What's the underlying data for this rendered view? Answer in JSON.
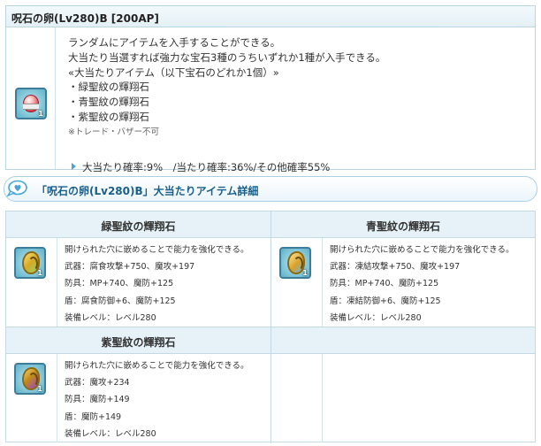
{
  "item": {
    "title": "呪石の卵(Lv280)B [200AP]",
    "icon": "red-egg-icon",
    "quantity": "1",
    "description": [
      "ランダムにアイテムを入手することができる。",
      "大当たり当選すれば強力な宝石3種のうちいずれか1種が入手できる。",
      "«大当たりアイテム（以下宝石のどれか1個）»",
      "・緑聖紋の輝翔石",
      "・青聖紋の輝翔石",
      "・紫聖紋の輝翔石"
    ],
    "note": "※トレード・バザー不可",
    "rates": "大当たり確率:9%　/当たり確率:36%/その他確率55%"
  },
  "section": {
    "icon": "heart-speech-icon",
    "title": "「呪石の卵(Lv280)B」大当たりアイテム詳細"
  },
  "jackpot_items": [
    {
      "name": "緑聖紋の輝翔石",
      "icon": "green-holy-stone-icon",
      "quantity": "1",
      "lines": [
        "開けられた穴に嵌めることで能力を強化できる。",
        "武器：腐食攻撃+750、魔攻+197",
        "防具：MP+740、魔防+125",
        "盾：腐食防御+6、魔防+125",
        "装備レベル：レベル280"
      ]
    },
    {
      "name": "青聖紋の輝翔石",
      "icon": "blue-holy-stone-icon",
      "quantity": "1",
      "lines": [
        "開けられた穴に嵌めることで能力を強化できる。",
        "武器：凍結攻撃+750、魔攻+197",
        "防具：MP+740、魔防+125",
        "盾：凍結防御+6、魔防+125",
        "装備レベル：レベル280"
      ]
    },
    {
      "name": "紫聖紋の輝翔石",
      "icon": "purple-holy-stone-icon",
      "quantity": "1",
      "lines": [
        "開けられた穴に嵌めることで能力を強化できる。",
        "武器：魔攻+234",
        "防具：魔防+149",
        "盾：魔防+149",
        "装備レベル：レベル280"
      ]
    }
  ]
}
